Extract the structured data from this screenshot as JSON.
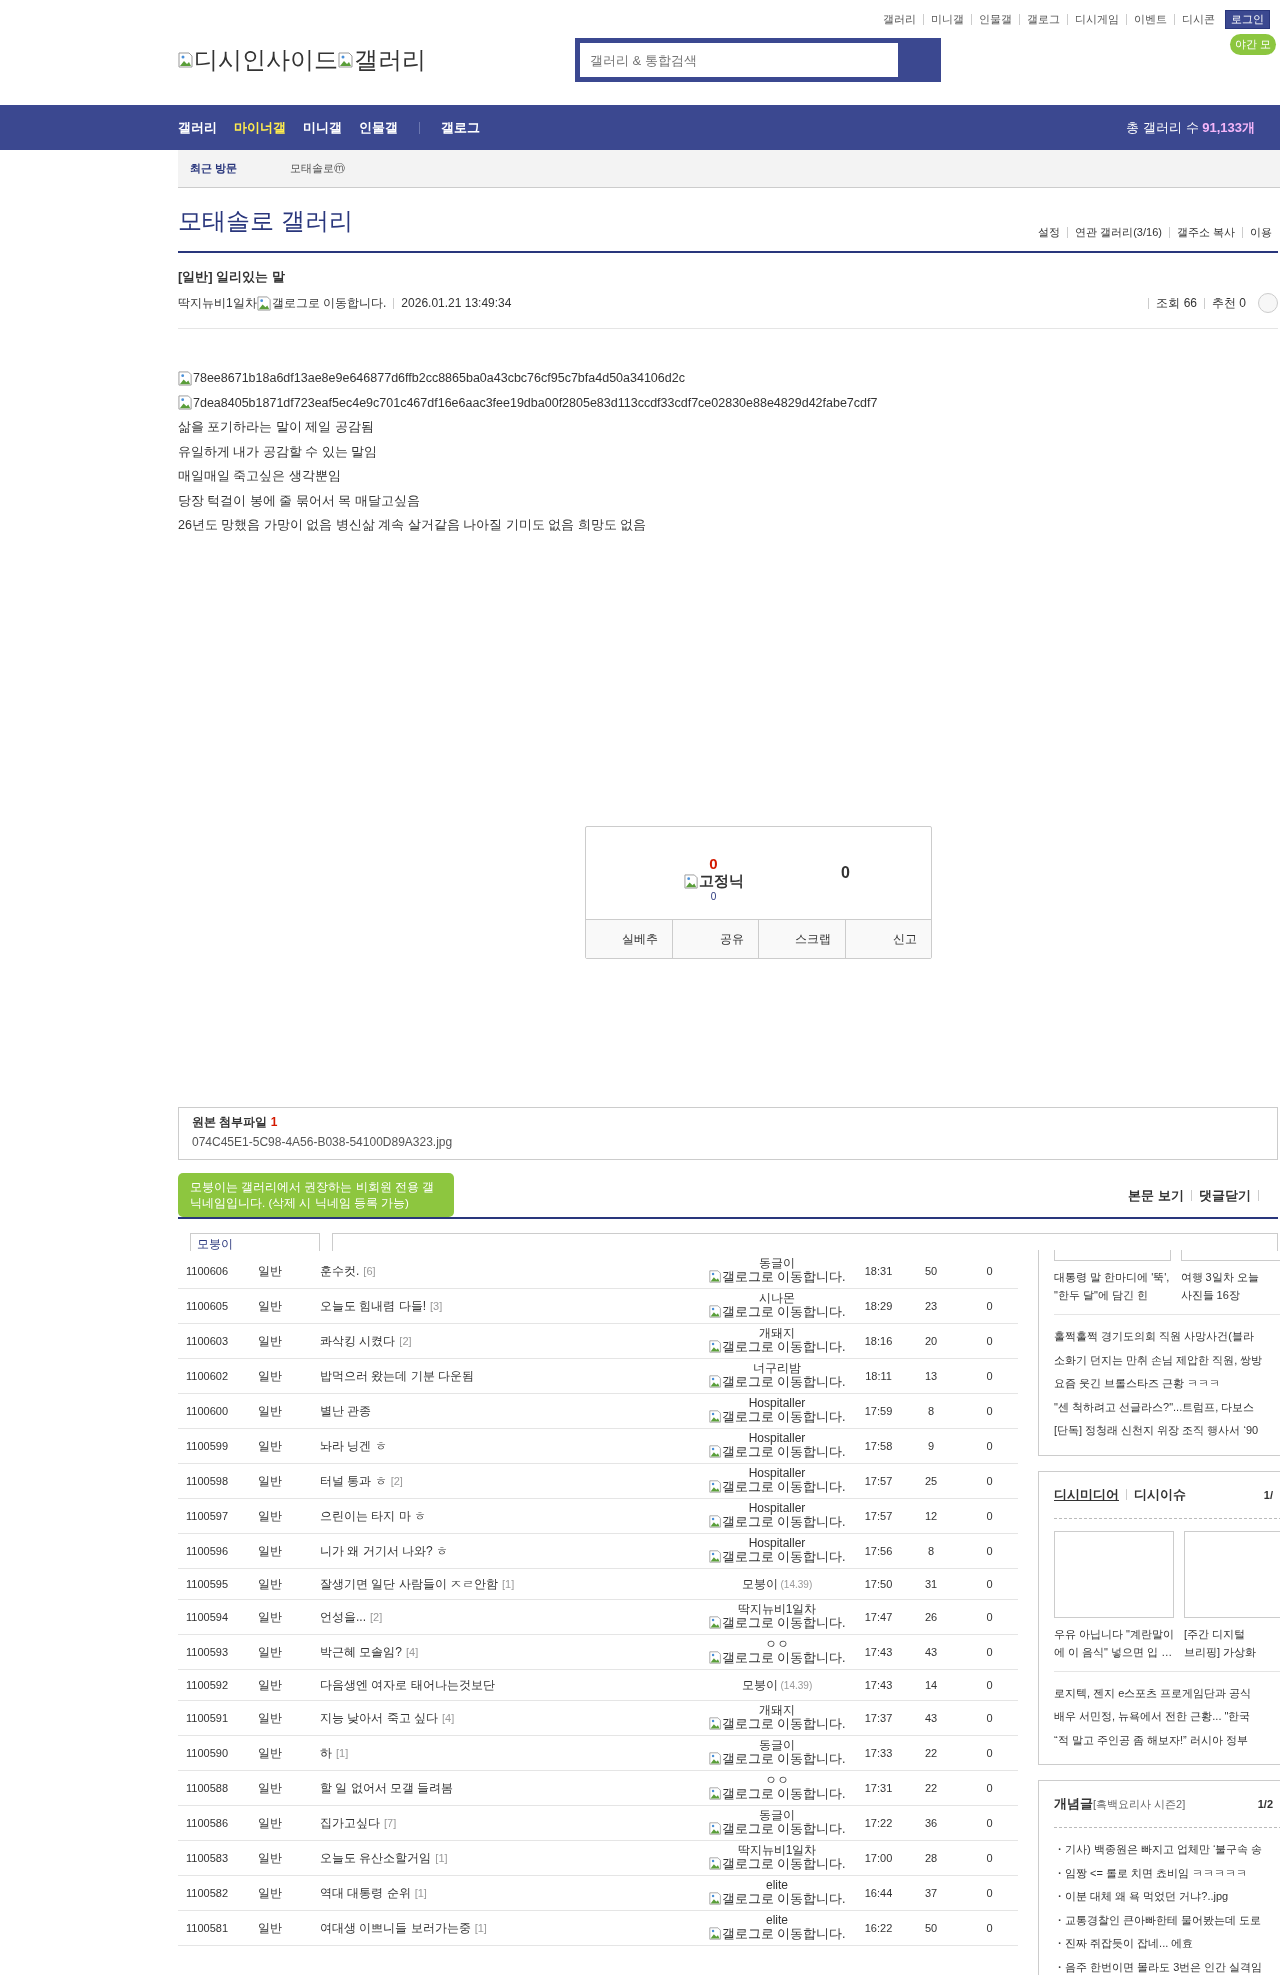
{
  "top_links": [
    "갤러리",
    "미니갤",
    "인물갤",
    "갤로그",
    "디시게임",
    "이벤트",
    "디시콘"
  ],
  "login_button": "로그인",
  "night_mode_button": "야간 모",
  "logo": {
    "site": "디시인사이드",
    "section": "갤러리"
  },
  "search": {
    "placeholder": "갤러리 & 통합검색"
  },
  "nav": {
    "items": [
      {
        "label": "갤러리",
        "selected": false
      },
      {
        "label": "마이너갤",
        "selected": true
      },
      {
        "label": "미니갤",
        "selected": false
      },
      {
        "label": "인물갤",
        "selected": false
      },
      {
        "label": "갤로그",
        "selected": false
      }
    ],
    "total_label": "총 갤러리 수 ",
    "total_value": "91,133개"
  },
  "recent": {
    "label": "최근 방문",
    "items": [
      "모태솔로ⓜ"
    ]
  },
  "gallery": {
    "title": "모태솔로 갤러리",
    "links": [
      "설정",
      "연관 갤러리(3/16)",
      "갤주소 복사",
      "이용"
    ]
  },
  "post": {
    "title": "[일반] 일리있는 말",
    "author": "딱지뉴비1일차",
    "gallog": "갤로그로 이동합니다.",
    "date": "2026.01.21 13:49:34",
    "views": "조회 66",
    "recommend": "추천 0",
    "body": [
      {
        "kind": "image",
        "text": "78ee8671b18a6df13ae8e9e646877d6ffb2cc8865ba0a43cbc76cf95c7bfa4d50a34106d2c"
      },
      {
        "kind": "image",
        "text": "7dea8405b1871df723eaf5ec4e9c701c467df16e6aac3fee19dba00f2805e83d113ccdf33cdf7ce02830e88e4829d42fabe7cdf7"
      },
      {
        "kind": "text",
        "text": "삶을 포기하라는 말이 제일 공감됨"
      },
      {
        "kind": "text",
        "text": "유일하게 내가 공감할 수 있는 말임"
      },
      {
        "kind": "text",
        "text": "매일매일 죽고싶은 생각뿐임"
      },
      {
        "kind": "text",
        "text": "당장 턱걸이 봉에 줄 묶어서 목 매달고싶음"
      },
      {
        "kind": "text",
        "text": "26년도 망했음 가망이 없음 병신삶 계속 살거같음 나아질 기미도 없음 희망도 없음"
      }
    ]
  },
  "vote": {
    "up": "0",
    "fixed_nick": "고정닉",
    "fixed_count": "0",
    "down": "0",
    "buttons": [
      "실베추",
      "공유",
      "스크랩",
      "신고"
    ]
  },
  "attachment": {
    "label": "원본 첨부파일 ",
    "count": "1",
    "file": "074C45E1-5C98-4A56-B038-54100D89A323.jpg"
  },
  "comments": {
    "links": [
      "본문 보기",
      "댓글닫기"
    ],
    "tooltip": "모붕이는 갤러리에서 권장하는 비회원 전용 갤닉네임입니다. (삭제 시 닉네임 등록 가능)",
    "nickname": "모붕이"
  },
  "list": {
    "rows": [
      {
        "num": "1100606",
        "type": "일반",
        "title": "훈수컷.",
        "replies": "[6]",
        "writer": {
          "name": "동글이",
          "gallog": "갤로그로 이동합니다."
        },
        "date": "18:31",
        "views": "50",
        "recommend": "0"
      },
      {
        "num": "1100605",
        "type": "일반",
        "title": "오늘도 힘내렴 다들!",
        "replies": "[3]",
        "writer": {
          "name": "시나몬",
          "gallog": "갤로그로 이동합니다."
        },
        "date": "18:29",
        "views": "23",
        "recommend": "0"
      },
      {
        "num": "1100603",
        "type": "일반",
        "title": "콰삭킹 시켰다",
        "replies": "[2]",
        "writer": {
          "name": "개돼지",
          "gallog": "갤로그로 이동합니다."
        },
        "date": "18:16",
        "views": "20",
        "recommend": "0"
      },
      {
        "num": "1100602",
        "type": "일반",
        "title": "밥먹으러 왔는데 기분 다운됨",
        "writer": {
          "name": "너구리밤",
          "gallog": "갤로그로 이동합니다."
        },
        "date": "18:11",
        "views": "13",
        "recommend": "0"
      },
      {
        "num": "1100600",
        "type": "일반",
        "title": "별난 관종",
        "writer": {
          "name": "Hospitaller",
          "gallog": "갤로그로 이동합니다."
        },
        "date": "17:59",
        "views": "8",
        "recommend": "0"
      },
      {
        "num": "1100599",
        "type": "일반",
        "title": "놔라 닝겐 ㅎ",
        "writer": {
          "name": "Hospitaller",
          "gallog": "갤로그로 이동합니다."
        },
        "date": "17:58",
        "views": "9",
        "recommend": "0"
      },
      {
        "num": "1100598",
        "type": "일반",
        "title": "터널 통과 ㅎ",
        "replies": "[2]",
        "writer": {
          "name": "Hospitaller",
          "gallog": "갤로그로 이동합니다."
        },
        "date": "17:57",
        "views": "25",
        "recommend": "0"
      },
      {
        "num": "1100597",
        "type": "일반",
        "title": "으린이는 타지 마 ㅎ",
        "writer": {
          "name": "Hospitaller",
          "gallog": "갤로그로 이동합니다."
        },
        "date": "17:57",
        "views": "12",
        "recommend": "0"
      },
      {
        "num": "1100596",
        "type": "일반",
        "title": "니가 왜 거기서 나와? ㅎ",
        "writer": {
          "name": "Hospitaller",
          "gallog": "갤로그로 이동합니다."
        },
        "date": "17:56",
        "views": "8",
        "recommend": "0"
      },
      {
        "num": "1100595",
        "type": "일반",
        "title": "잘생기면 일단 사람들이 ㅈㄹ안함",
        "replies": "[1]",
        "writer": {
          "name": "모붕이",
          "ip": "(14.39)"
        },
        "date": "17:50",
        "views": "31",
        "recommend": "0"
      },
      {
        "num": "1100594",
        "type": "일반",
        "title": "언성을...",
        "replies": "[2]",
        "writer": {
          "name": "딱지뉴비1일차",
          "gallog": "갤로그로 이동합니다."
        },
        "date": "17:47",
        "views": "26",
        "recommend": "0"
      },
      {
        "num": "1100593",
        "type": "일반",
        "title": "박근혜 모솔임?",
        "replies": "[4]",
        "writer": {
          "name": "ㅇㅇ",
          "gallog": "갤로그로 이동합니다."
        },
        "date": "17:43",
        "views": "43",
        "recommend": "0"
      },
      {
        "num": "1100592",
        "type": "일반",
        "title": "다음생엔 여자로 태어나는것보단",
        "writer": {
          "name": "모붕이",
          "ip": "(14.39)"
        },
        "date": "17:43",
        "views": "14",
        "recommend": "0"
      },
      {
        "num": "1100591",
        "type": "일반",
        "title": "지능 낮아서 죽고 싶다",
        "replies": "[4]",
        "writer": {
          "name": "개돼지",
          "gallog": "갤로그로 이동합니다."
        },
        "date": "17:37",
        "views": "43",
        "recommend": "0"
      },
      {
        "num": "1100590",
        "type": "일반",
        "title": "하",
        "replies": "[1]",
        "writer": {
          "name": "동글이",
          "gallog": "갤로그로 이동합니다."
        },
        "date": "17:33",
        "views": "22",
        "recommend": "0"
      },
      {
        "num": "1100588",
        "type": "일반",
        "title": "할 일 없어서 모갤 들려봄",
        "writer": {
          "name": "ㅇㅇ",
          "gallog": "갤로그로 이동합니다."
        },
        "date": "17:31",
        "views": "22",
        "recommend": "0"
      },
      {
        "num": "1100586",
        "type": "일반",
        "title": "집가고싶다",
        "replies": "[7]",
        "writer": {
          "name": "동글이",
          "gallog": "갤로그로 이동합니다."
        },
        "date": "17:22",
        "views": "36",
        "recommend": "0"
      },
      {
        "num": "1100583",
        "type": "일반",
        "title": "오늘도 유산소할거임",
        "replies": "[1]",
        "writer": {
          "name": "딱지뉴비1일차",
          "gallog": "갤로그로 이동합니다."
        },
        "date": "17:00",
        "views": "28",
        "recommend": "0"
      },
      {
        "num": "1100582",
        "type": "일반",
        "title": "역대 대통령 순위",
        "replies": "[1]",
        "writer": {
          "name": "elite",
          "gallog": "갤로그로 이동합니다."
        },
        "date": "16:44",
        "views": "37",
        "recommend": "0"
      },
      {
        "num": "1100581",
        "type": "일반",
        "title": "여대생 이쁘니들 보러가는중",
        "replies": "[1]",
        "writer": {
          "name": "elite",
          "gallog": "갤로그로 이동합니다."
        },
        "date": "16:22",
        "views": "50",
        "recommend": "0"
      }
    ]
  },
  "sidebar": {
    "boxes": [
      {
        "kind": "news",
        "captions": [
          [
            "대통령 말 한마디에 '뚝',",
            "\"한두 달\"에 담긴 힌"
          ],
          [
            "여행 3일차 오늘",
            "사진들 16장"
          ]
        ],
        "items": [
          "훌쩍훌쩍 경기도의회 직원 사망사건(블라",
          "소화기 던지는 만취 손님 제압한 직원, 쌍방",
          "요즘 웃긴 브롤스타즈 근황 ㅋㅋㅋ",
          "\"센 척하려고 선글라스?\"...트럼프, 다보스",
          "[단독] 정청래 신천지 위장 조직 행사서 ‘90"
        ]
      },
      {
        "kind": "media",
        "tabs": [
          {
            "label": "디시미디어",
            "selected": true
          },
          {
            "label": "디시이슈",
            "selected": false
          }
        ],
        "page": "1/",
        "captions": [
          [
            "우유 아닙니다 \"계란말이",
            "에 이 음식\" 넣으면 입 …"
          ],
          [
            "[주간 디지털",
            "브리핑] 가상화"
          ]
        ],
        "items": [
          "로지텍, 젠지 e스포츠 프로게임단과 공식",
          "배우 서민정, 뉴욕에서 전한 근황... \"한국",
          "“적 말고 주인공 좀 해보자!” 러시아 정부"
        ]
      },
      {
        "kind": "concept",
        "title": "개념글",
        "subtitle": "[흑백요리사 시즌2]",
        "page": "1/2",
        "items": [
          "・기사) 백종원은 빠지고 업체만 ‘불구속 송",
          "・임짱 <= 롤로 치면 쵸비임 ㅋㅋㅋㅋㅋ",
          "・이분 대체 왜 욕 먹었던 거냐?..jpg",
          "・교통경찰인 큰아빠한테 물어봤는데 도로",
          "・진짜 쥐잡듯이 잡네... 에효",
          "・음주 한번이면 몰라도 3번은 인간 실격임"
        ]
      }
    ]
  }
}
